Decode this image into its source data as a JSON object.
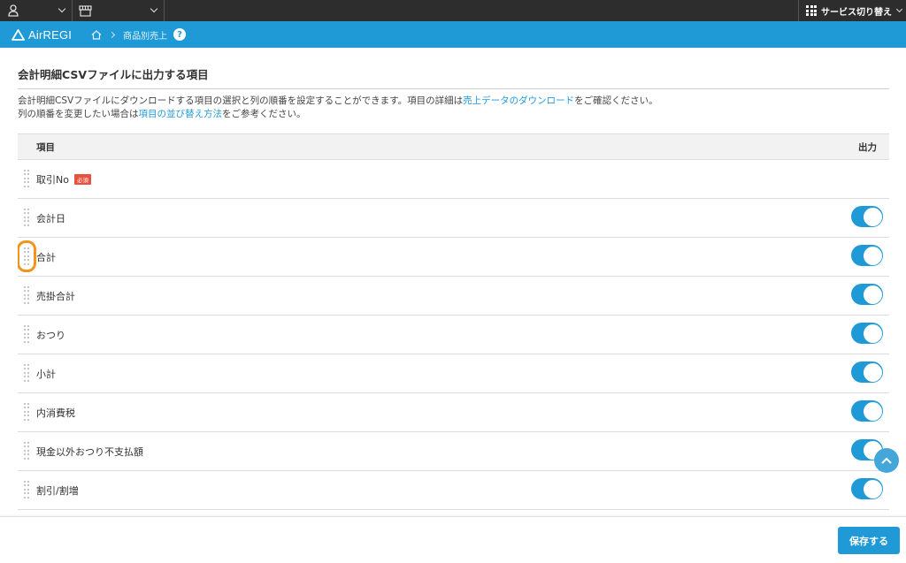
{
  "topbar": {
    "service_switch_label": "サービス切り替え"
  },
  "header": {
    "brand": "AirREGI",
    "breadcrumb_current": "商品別売上",
    "help": "?"
  },
  "section": {
    "title": "会計明細CSVファイルに出力する項目",
    "desc_line1_pre": "会計明細CSVファイルにダウンロードする項目の選択と列の順番を設定することができます。項目の詳細は",
    "desc_line1_link": "売上データのダウンロード",
    "desc_line1_post": "をご確認ください。",
    "desc_line2_pre": "列の順番を変更したい場合は",
    "desc_line2_link": "項目の並び替え方法",
    "desc_line2_post": "をご参考ください。"
  },
  "table": {
    "col_item": "項目",
    "col_output": "出力",
    "rows": [
      {
        "label": "取引No",
        "badge": "必須",
        "output": null
      },
      {
        "label": "会計日",
        "output": true
      },
      {
        "label": "合計",
        "output": true
      },
      {
        "label": "売掛合計",
        "output": true
      },
      {
        "label": "おつり",
        "output": true
      },
      {
        "label": "小計",
        "output": true
      },
      {
        "label": "内消費税",
        "output": true
      },
      {
        "label": "現金以外おつり不支払額",
        "output": true
      },
      {
        "label": "割引/割増",
        "output": true
      }
    ]
  },
  "footer": {
    "save_label": "保存する"
  },
  "colors": {
    "brand": "#1f9ad6",
    "highlight": "#f0961c",
    "required": "#e8513d"
  }
}
